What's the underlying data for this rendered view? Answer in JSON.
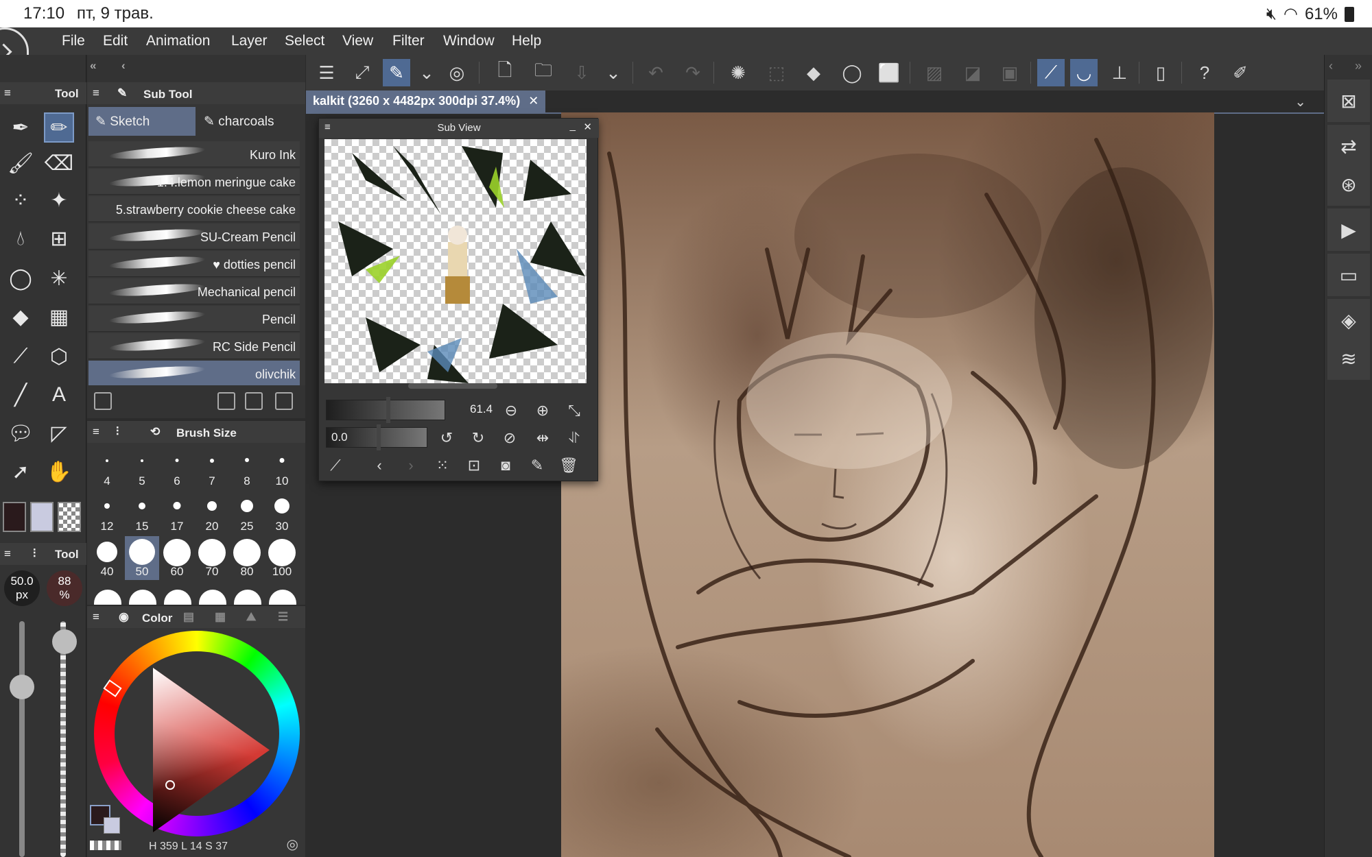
{
  "status_bar": {
    "time": "17:10",
    "date": "пт, 9 трав.",
    "battery": "61%"
  },
  "menu": [
    "File",
    "Edit",
    "Animation",
    "Layer",
    "Select",
    "View",
    "Filter",
    "Window",
    "Help"
  ],
  "tool_panel": {
    "title": "Tool",
    "property_title": "Tool",
    "brush_size": "50.0",
    "brush_size_unit": "px",
    "opacity": "88",
    "opacity_unit": "%"
  },
  "sub_tool": {
    "title": "Sub Tool",
    "tabs": [
      "Sketch",
      "charcoals"
    ],
    "brushes": [
      "Kuro Ink",
      "1.4.lemon meringue cake",
      "5.strawberry cookie cheese cake",
      "SU-Cream Pencil",
      "♥ dotties pencil",
      "Mechanical pencil",
      "Pencil",
      "RC Side Pencil",
      "olivchik"
    ],
    "selected_brush": "olivchik"
  },
  "brush_size_panel": {
    "title": "Brush Size",
    "sizes": [
      "4",
      "5",
      "6",
      "7",
      "8",
      "10",
      "12",
      "15",
      "17",
      "20",
      "25",
      "30",
      "40",
      "50",
      "60",
      "70",
      "80",
      "100"
    ],
    "selected": "50"
  },
  "color_panel": {
    "title": "Color",
    "h": "359",
    "s": "14",
    "v": "37"
  },
  "document": {
    "tab_title": "kalkit (3260 x 4482px 300dpi 37.4%)"
  },
  "sub_view": {
    "title": "Sub View",
    "zoom": "61.4",
    "rotation": "0.0"
  },
  "colors": {
    "accent": "#5f6d88",
    "main_color": "#2a1a1c",
    "sub_color": "#c9cbe0"
  }
}
